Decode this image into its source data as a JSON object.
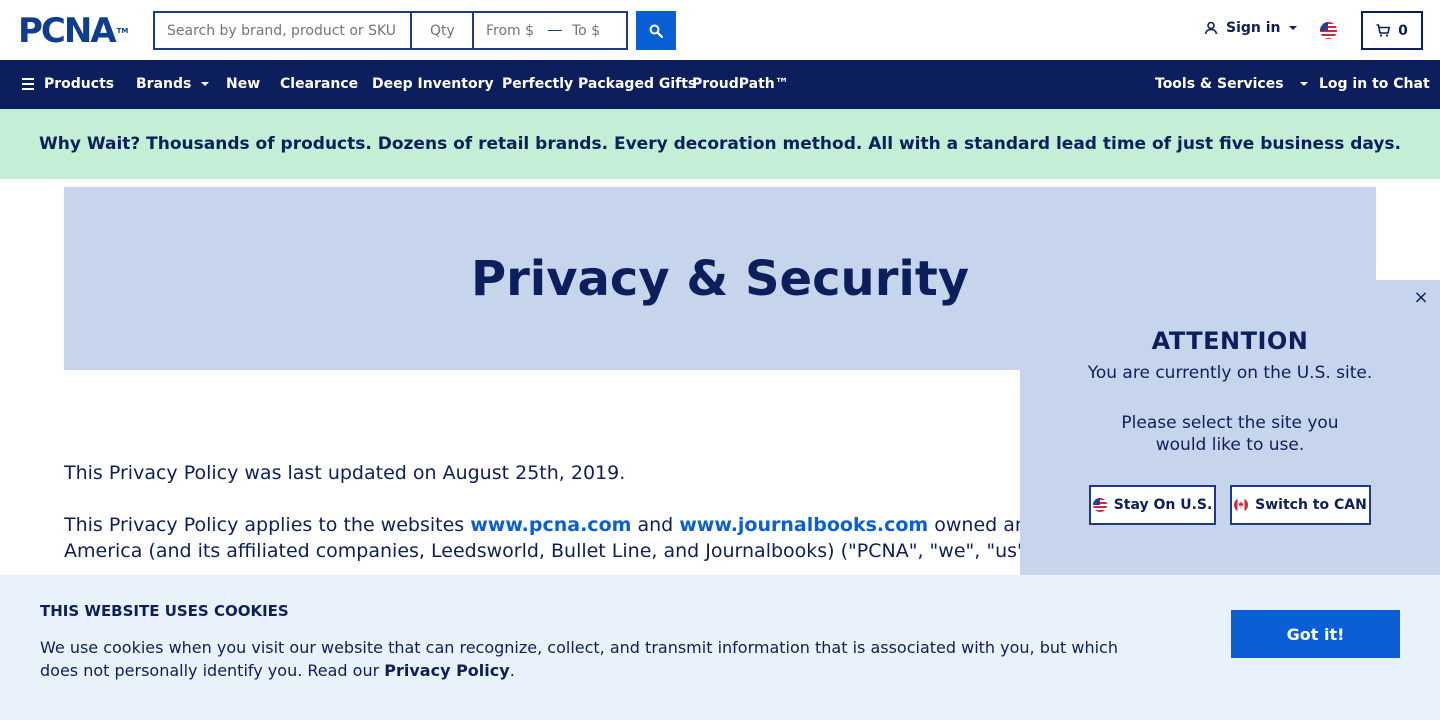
{
  "header": {
    "logo_text": "PCNA",
    "logo_tm": "TM",
    "search": {
      "placeholder": "Search by brand, product or SKU",
      "value": ""
    },
    "qty": {
      "placeholder": "Qty"
    },
    "price_from": {
      "placeholder": "From $"
    },
    "price_to": {
      "placeholder": "To $"
    },
    "signin_label": "Sign in",
    "cart_count": "0"
  },
  "nav": {
    "products": "Products",
    "brands": "Brands",
    "new": "New",
    "clearance": "Clearance",
    "deep_inventory": "Deep Inventory",
    "gifts": "Perfectly Packaged Gifts",
    "proudpath": "ProudPath™",
    "tools": "Tools & Services",
    "chat": "Log in to Chat"
  },
  "promo": {
    "text": "Why Wait? Thousands of products. Dozens of retail brands. Every decoration method. All with a standard lead time of just five business days."
  },
  "hero": {
    "title": "Privacy & Security"
  },
  "content": {
    "updated": "This Privacy Policy was last updated on August 25th, 2019.",
    "p2_a": "This Privacy Policy applies to the websites ",
    "link1": "www.pcna.com",
    "p2_b": " and ",
    "link2": "www.journalbooks.com",
    "p2_c": " owned and o",
    "p2_line2": "America (and its affiliated companies, Leedsworld, Bullet Line, and Journalbooks) (\"PCNA\", \"we\", \"us\", o"
  },
  "site_modal": {
    "close": "×",
    "title": "ATTENTION",
    "line1": "You are currently on the U.S. site.",
    "line2": "Please select the site you would like to use.",
    "stay_label": "Stay On U.S.",
    "switch_label": "Switch to CAN"
  },
  "cookie": {
    "title": "THIS WEBSITE USES COOKIES",
    "text": "We use cookies when you visit our website that can recognize, collect, and transmit information that is associated with you, but which does not personally identify you. Read our ",
    "link": "Privacy Policy",
    "text_end": ".",
    "button": "Got it!"
  },
  "colors": {
    "navy": "#0c1f5c",
    "accent_blue": "#0b5fd6",
    "promo_green": "#c4eed6",
    "hero_blue": "#c6d5ec",
    "cookie_bg": "#e9f1fb"
  },
  "icons": {
    "search": "search-icon",
    "user": "user-icon",
    "flag": "us-flag-icon",
    "cart": "cart-icon",
    "menu": "hamburger-icon",
    "close": "close-icon"
  }
}
